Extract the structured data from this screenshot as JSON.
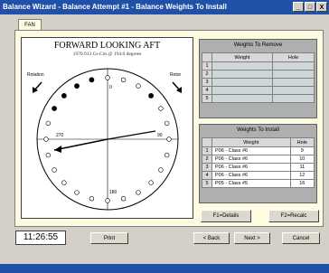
{
  "window": {
    "title": "Balance Wizard - Balance Attempt #1 - Balance Weights To Install",
    "minimize_glyph": "_",
    "maximize_glyph": "□",
    "close_glyph": "X"
  },
  "tabs": [
    {
      "label": "FAN"
    }
  ],
  "diagram": {
    "title": "FORWARD LOOKING AFT",
    "subtitle": "1970.913 Gr-Cm @ 194.0 degrees",
    "rotation_label": "Rotation",
    "rotation_right_label": "Rotor",
    "pos_top": "0",
    "pos_right": "90",
    "pos_bottom": "180",
    "pos_left": "270"
  },
  "weights_to_remove": {
    "title": "Weights To Remove",
    "columns": [
      "Weight",
      "Hole"
    ],
    "rows": [
      {
        "idx": "1",
        "weight": "",
        "hole": ""
      },
      {
        "idx": "2",
        "weight": "",
        "hole": ""
      },
      {
        "idx": "3",
        "weight": "",
        "hole": ""
      },
      {
        "idx": "4",
        "weight": "",
        "hole": ""
      },
      {
        "idx": "5",
        "weight": "",
        "hole": ""
      }
    ]
  },
  "weights_to_install": {
    "title": "Weights To Install",
    "columns": [
      "Weight",
      "Hole"
    ],
    "rows": [
      {
        "idx": "1",
        "weight": "P06 - Class #6",
        "hole": "9"
      },
      {
        "idx": "2",
        "weight": "P06 - Class #6",
        "hole": "10"
      },
      {
        "idx": "3",
        "weight": "P06 - Class #6",
        "hole": "11"
      },
      {
        "idx": "4",
        "weight": "P06 - Class #6",
        "hole": "12"
      },
      {
        "idx": "5",
        "weight": "P05 - Class #5",
        "hole": "16"
      }
    ]
  },
  "buttons": {
    "details": "F1=Details",
    "recalc": "F2=Recalc",
    "print": "Print",
    "back": "< Back",
    "next": "Next >",
    "cancel": "Cancel"
  },
  "status": {
    "time": "11:26:55"
  },
  "colors": {
    "title_bar": "#2050a8",
    "panel": "#fffbe0",
    "weight_dot": "#000000"
  }
}
